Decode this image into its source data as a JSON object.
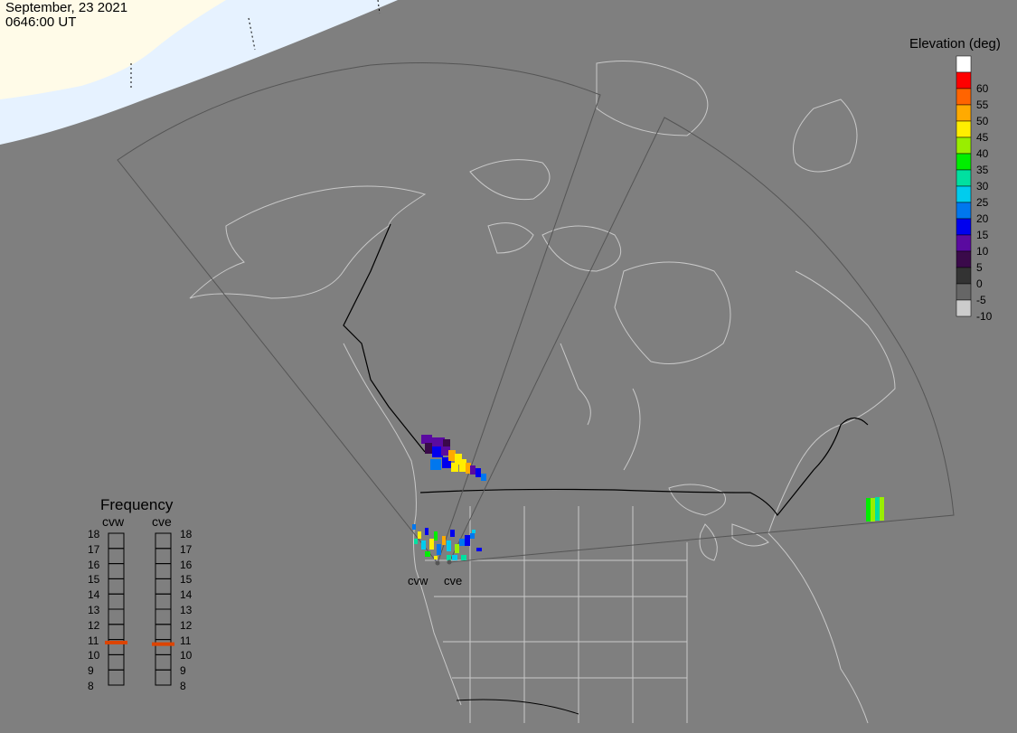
{
  "header": {
    "date": "September, 23 2021",
    "time": "0646:00 UT"
  },
  "elevation_legend": {
    "title": "Elevation (deg)",
    "items": [
      {
        "label": "",
        "color": "#ffffff"
      },
      {
        "label": "60",
        "color": "#ff0000"
      },
      {
        "label": "55",
        "color": "#ff6400"
      },
      {
        "label": "50",
        "color": "#ffaa00"
      },
      {
        "label": "45",
        "color": "#ffee00"
      },
      {
        "label": "40",
        "color": "#99ee00"
      },
      {
        "label": "35",
        "color": "#00ee00"
      },
      {
        "label": "30",
        "color": "#00e0a0"
      },
      {
        "label": "25",
        "color": "#00ccee"
      },
      {
        "label": "20",
        "color": "#0077ee"
      },
      {
        "label": "15",
        "color": "#0000ee"
      },
      {
        "label": "10",
        "color": "#5a0aa0"
      },
      {
        "label": "5",
        "color": "#3a0a4a"
      },
      {
        "label": "0",
        "color": "#333333"
      },
      {
        "label": "-5",
        "color": "#666666"
      },
      {
        "label": "-10",
        "color": "#cccccc"
      }
    ]
  },
  "frequency": {
    "title": "Frequency",
    "radars": [
      {
        "name": "cvw",
        "frequency_mhz": 10.8
      },
      {
        "name": "cve",
        "frequency_mhz": 10.7
      }
    ],
    "ticks": [
      "18",
      "17",
      "16",
      "15",
      "14",
      "13",
      "12",
      "11",
      "10",
      "9",
      "8"
    ],
    "marker_color": "#dd4400"
  },
  "radars": [
    {
      "name": "cvw"
    },
    {
      "name": "cve"
    }
  ],
  "colors": {
    "background": "#7f7f7f",
    "coast": "#c8c8c8",
    "border": "#000000",
    "fov": "#555555",
    "daylight": "#fffbe8",
    "daylight_water": "#e6f2ff"
  }
}
